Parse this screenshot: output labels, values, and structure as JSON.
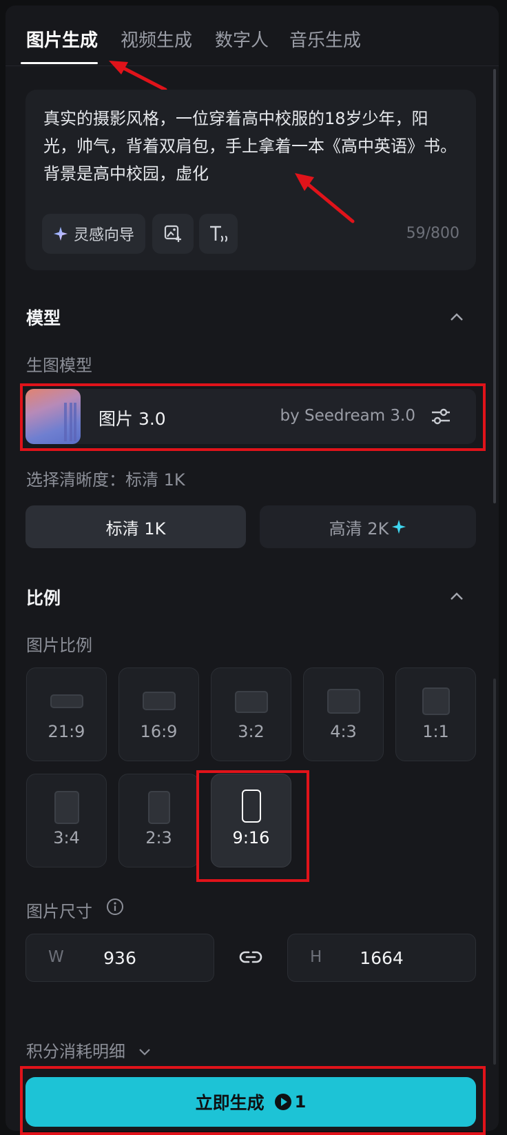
{
  "tabs": [
    "图片生成",
    "视频生成",
    "数字人",
    "音乐生成"
  ],
  "prompt": {
    "text": "真实的摄影风格，一位穿着高中校服的18岁少年，阳光，帅气，背着双肩包，手上拿着一本《高中英语》书。背景是高中校园，虚化",
    "inspiration_label": "灵感向导",
    "char_count": "59/800"
  },
  "model": {
    "section_title": "模型",
    "sub_label": "生图模型",
    "name": "图片 3.0",
    "by": "by Seedream 3.0"
  },
  "quality": {
    "current_label": "选择清晰度：标清 1K",
    "options": [
      "标清 1K",
      "高清 2K"
    ]
  },
  "ratio": {
    "section_title": "比例",
    "sub_label": "图片比例",
    "options": [
      "21:9",
      "16:9",
      "3:2",
      "4:3",
      "1:1",
      "3:4",
      "2:3",
      "9:16"
    ],
    "selected": "9:16"
  },
  "size": {
    "label": "图片尺寸",
    "w_prefix": "W",
    "w_value": "936",
    "h_prefix": "H",
    "h_value": "1664"
  },
  "credits": {
    "detail_label": "积分消耗明细"
  },
  "generate": {
    "label": "立即生成",
    "cost": "1"
  },
  "colors": {
    "accent": "#1dc3d6",
    "highlight": "#e0131a",
    "star": "#3fd6f0"
  }
}
